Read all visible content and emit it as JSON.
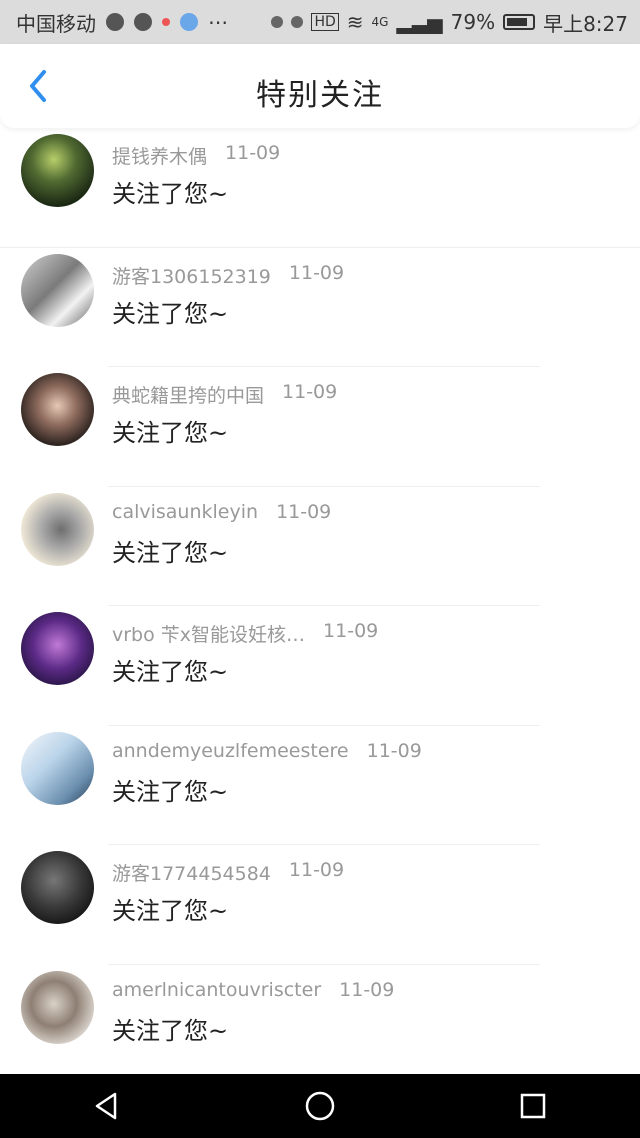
{
  "status_bar": {
    "carrier": "中国移动",
    "battery": "79%",
    "time": "早上8:27",
    "network": "4G",
    "hd": "HD"
  },
  "header": {
    "title": "特别关注",
    "back_icon": "chevron-left-icon"
  },
  "items": [
    {
      "name": "提钱养木偶",
      "date": "11-09",
      "message": "关注了您~"
    },
    {
      "name": "游客1306152319",
      "date": "11-09",
      "message": "关注了您~"
    },
    {
      "name": "典蛇籍里挎的中国",
      "date": "11-09",
      "message": "关注了您~"
    },
    {
      "name": "calvisaunkleyin",
      "date": "11-09",
      "message": "关注了您~"
    },
    {
      "name": "vrbo 苄x智能设妊核…",
      "date": "11-09",
      "message": "关注了您~"
    },
    {
      "name": "anndemyeuzlfemeestere",
      "date": "11-09",
      "message": "关注了您~"
    },
    {
      "name": "游客1774454584",
      "date": "11-09",
      "message": "关注了您~"
    },
    {
      "name": "amerlnicantouvriscter",
      "date": "11-09",
      "message": "关注了您~"
    }
  ],
  "colors": {
    "accent": "#2f8ef0",
    "status_bar": "#dcdcdc",
    "nav_bar": "#000000"
  },
  "nav": {
    "back_icon": "triangle-back-icon",
    "home_icon": "circle-home-icon",
    "recent_icon": "square-recent-icon"
  }
}
